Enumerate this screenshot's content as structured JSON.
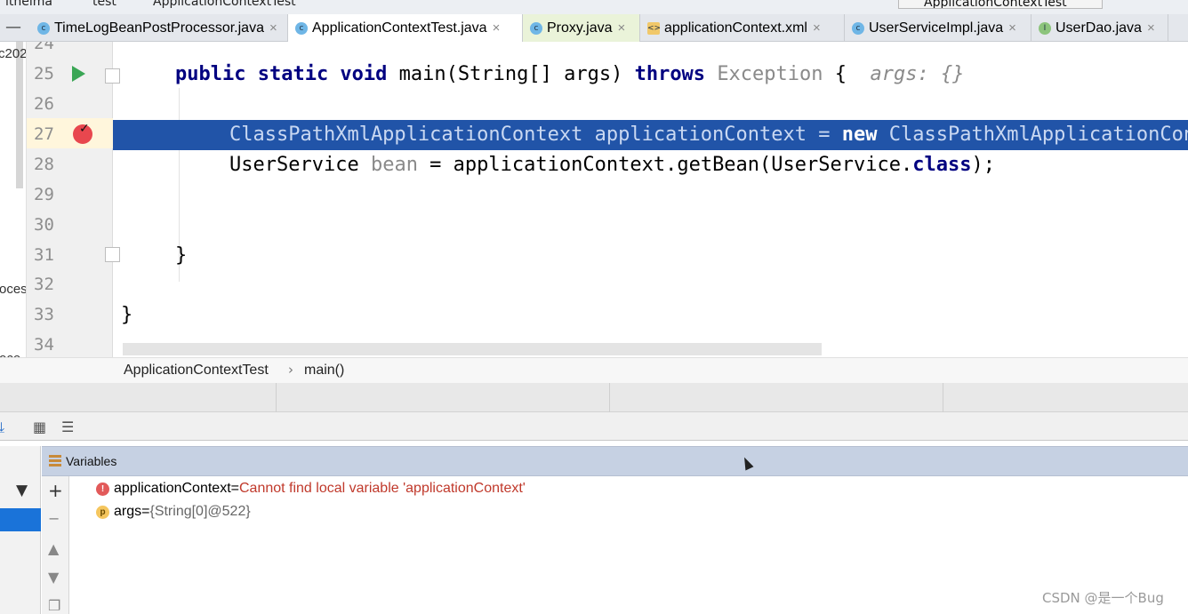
{
  "top": {
    "crumbs": [
      "itheima",
      "test",
      "ApplicationContextTest"
    ],
    "run_config": "ApplicationContextTest"
  },
  "tabs": [
    {
      "label": "TimeLogBeanPostProcessor.java",
      "icon": "class-icon",
      "active": false
    },
    {
      "label": "ApplicationContextTest.java",
      "icon": "class-icon",
      "active": true
    },
    {
      "label": "Proxy.java",
      "icon": "class-icon",
      "active": false
    },
    {
      "label": "applicationContext.xml",
      "icon": "xml-file-icon",
      "active": false
    },
    {
      "label": "UserServiceImpl.java",
      "icon": "class-icon",
      "active": false
    },
    {
      "label": "UserDao.java",
      "icon": "interface-icon",
      "active": false
    }
  ],
  "left_strip": [
    "c202",
    "roces",
    "roce"
  ],
  "editor": {
    "line_numbers": [
      "24",
      "25",
      "26",
      "27",
      "28",
      "29",
      "30",
      "31",
      "32",
      "33",
      "34"
    ],
    "line25": {
      "kw1": "public static void",
      "t1": " main(String[] args) ",
      "kw2": "throws",
      "t2": " ",
      "type": "Exception",
      "t3": " {  ",
      "hint": "args: {}"
    },
    "line27": {
      "t1": "ClassPathXmlApplicationContext applicationContext = ",
      "kw": "new",
      "t2": " ClassPathXmlApplicationContext(\"applicationContext.xml\");"
    },
    "line28": {
      "t1": "UserService ",
      "var": "bean",
      "t2": " = applicationContext.getBean(UserService.",
      "kw": "class",
      "t3": ");"
    },
    "line31": "}",
    "line33": "}"
  },
  "breadcrumb": {
    "class": "ApplicationContextTest",
    "method": "main()"
  },
  "variables": {
    "title": "Variables",
    "rows": [
      {
        "name": "applicationContext",
        "eq": " = ",
        "value": "Cannot find local variable 'applicationContext'",
        "kind": "error"
      },
      {
        "name": "args",
        "eq": " = ",
        "value": "{String[0]@522}",
        "kind": "param"
      }
    ]
  },
  "watermark": "CSDN @是一个Bug"
}
